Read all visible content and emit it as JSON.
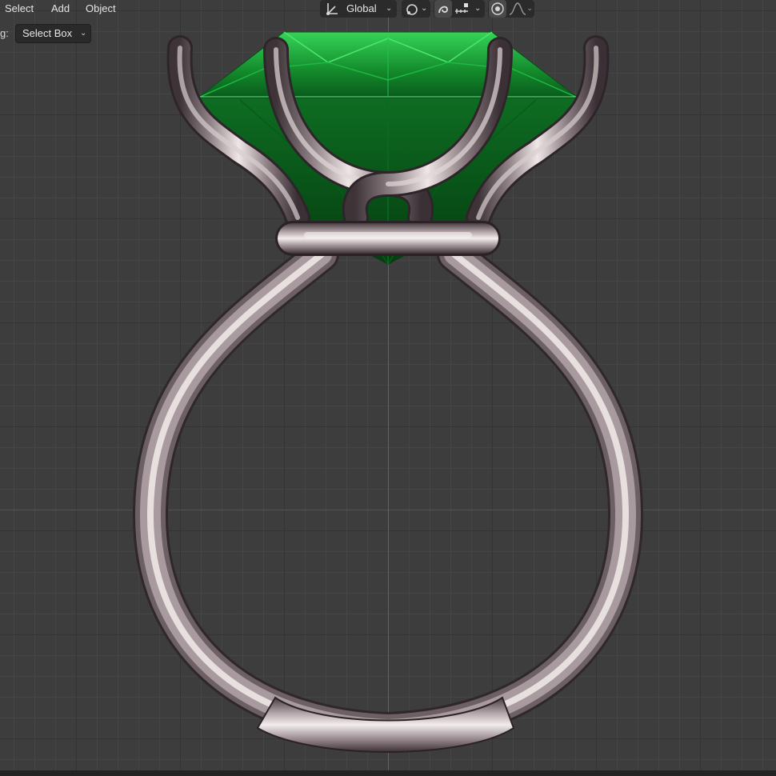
{
  "header": {
    "menu": [
      "Select",
      "Add",
      "Object"
    ],
    "transform_orientation": "Global"
  },
  "toolbar": {
    "prefix": "g:",
    "select_mode": "Select Box"
  },
  "colors": {
    "grid_bg": "#3d3d3d",
    "axis_x": "#8a3b40",
    "axis_z": "#3d6a9e",
    "gem": "#18a63a",
    "metal": "#c9bfc0"
  },
  "icons": [
    "transform-orientation-icon",
    "pivot-icon",
    "snap-icon",
    "snap-increment-icon",
    "proportional-edit-icon",
    "falloff-curve-icon"
  ]
}
